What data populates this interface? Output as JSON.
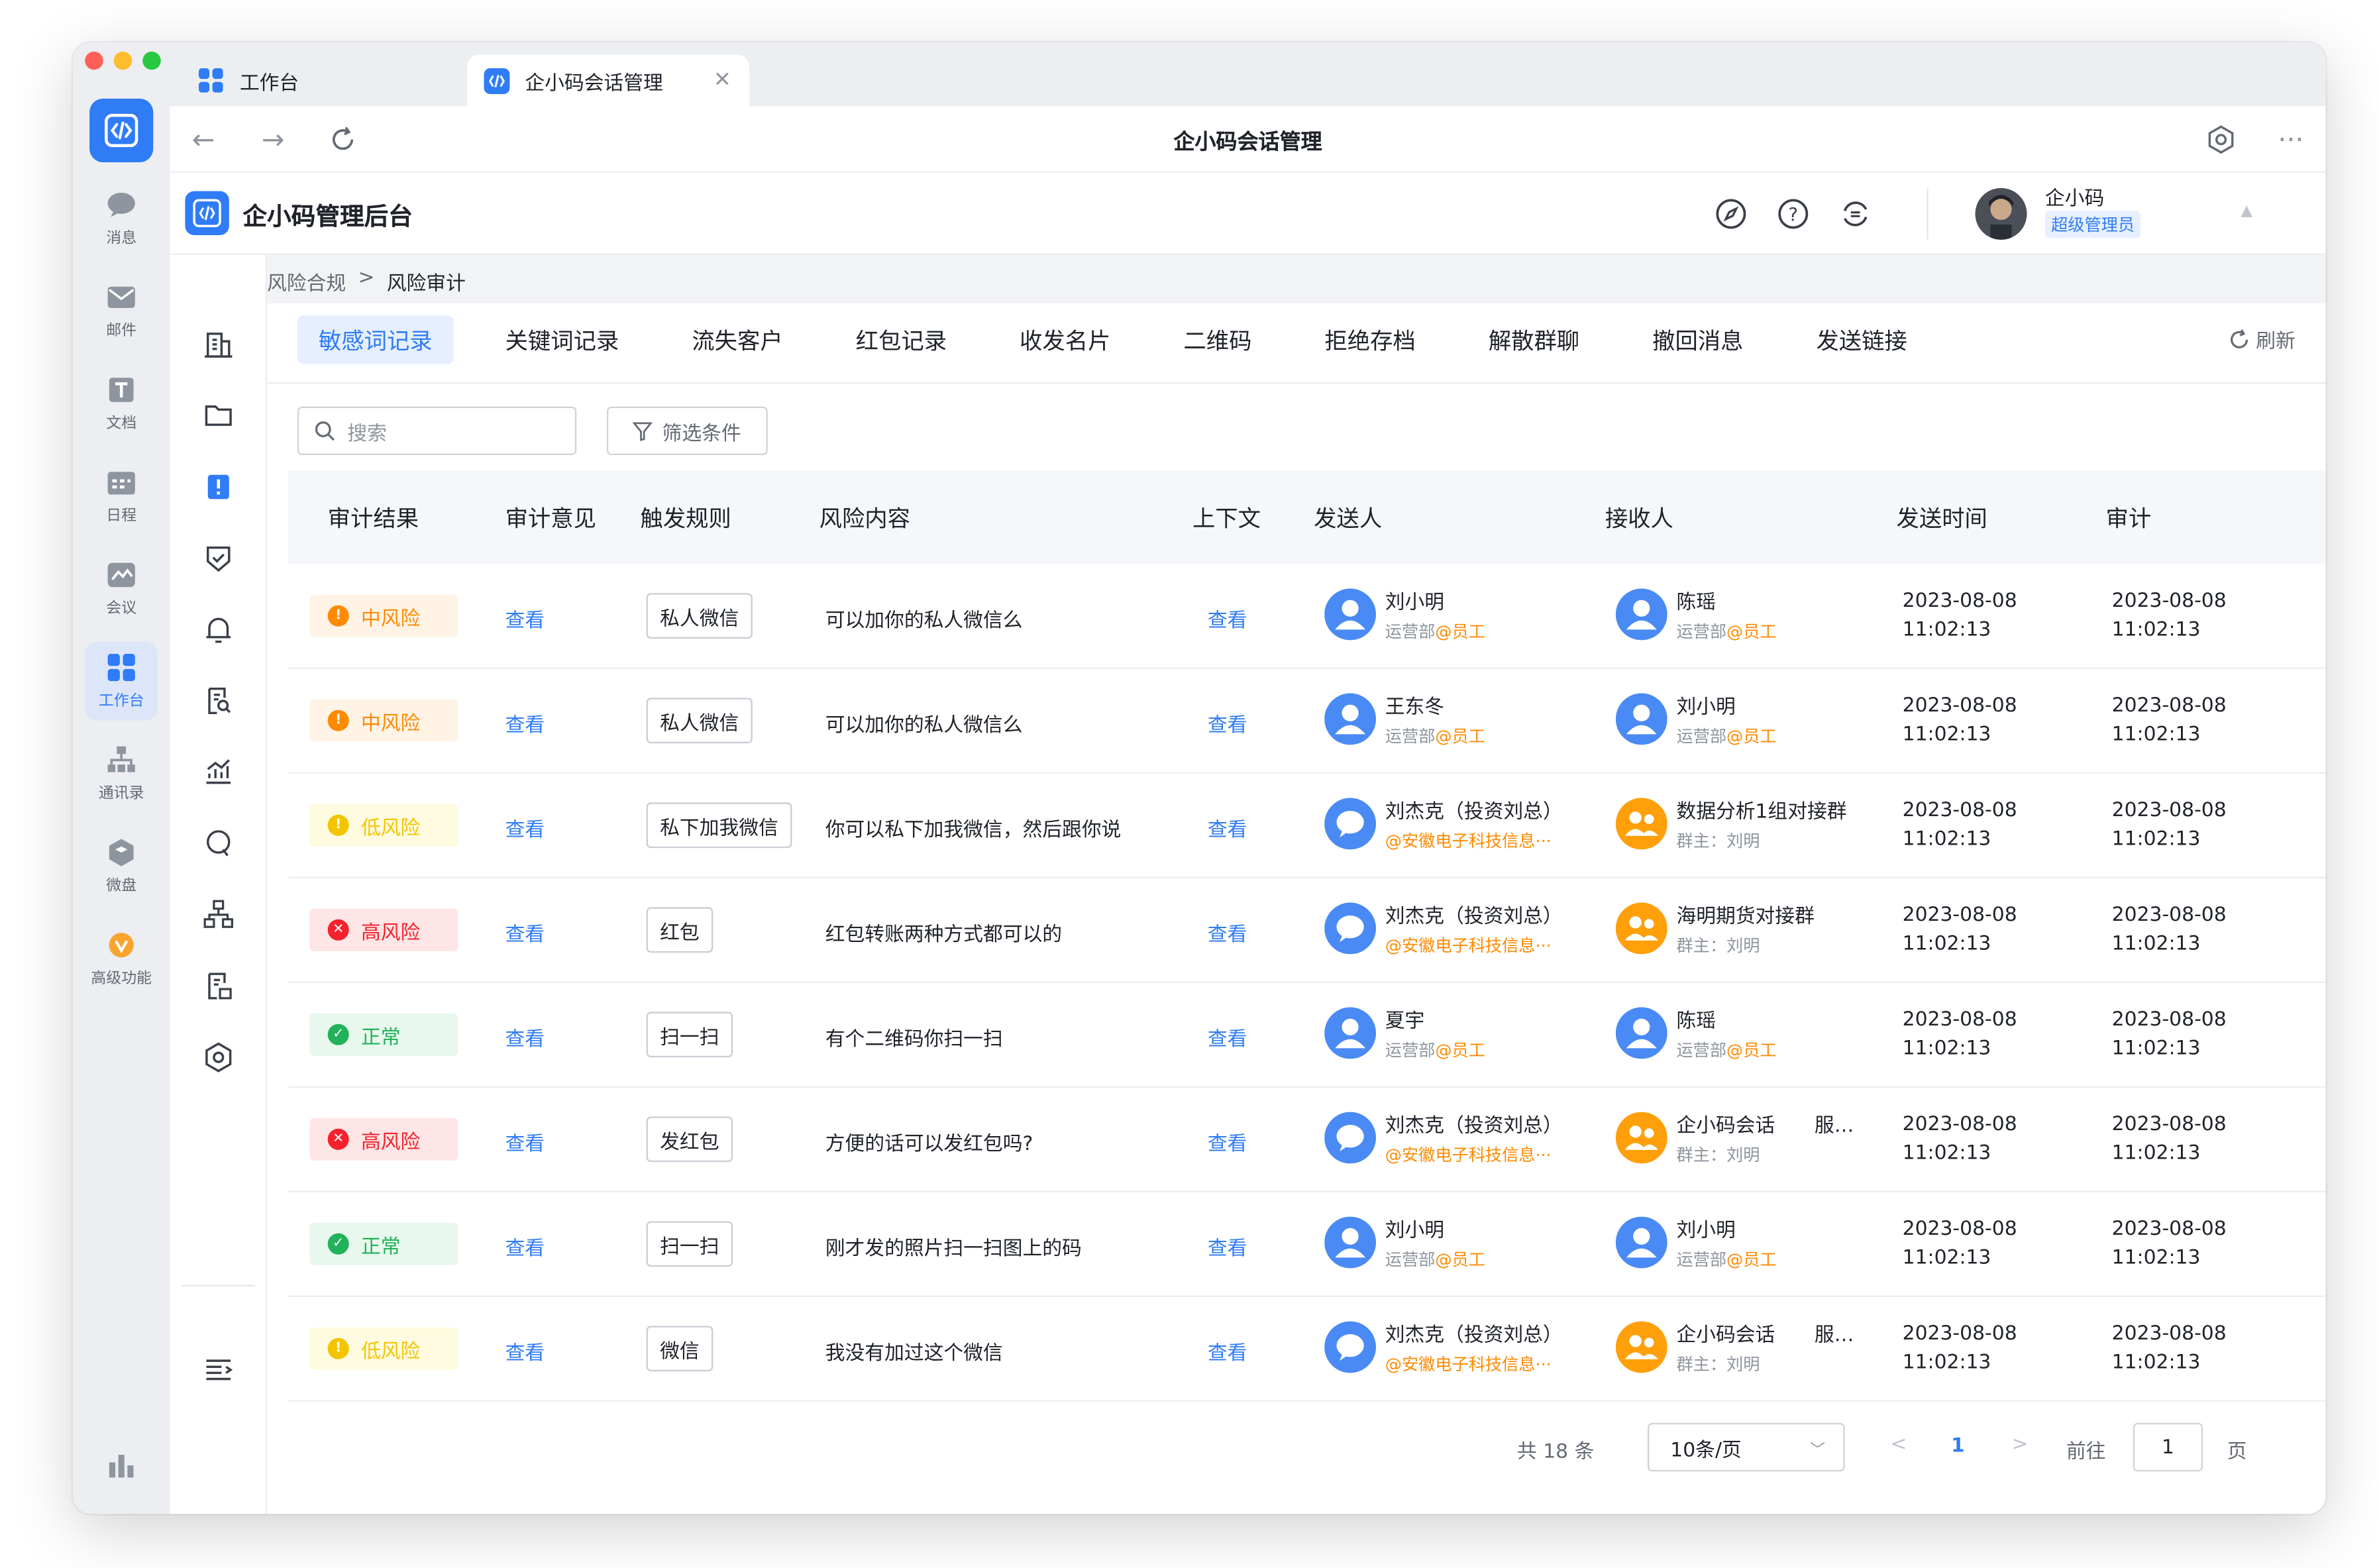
{
  "browser": {
    "tabs": [
      {
        "label": "工作台",
        "active": false
      },
      {
        "label": "企小码会话管理",
        "active": true
      }
    ],
    "page_title": "企小码会话管理"
  },
  "rail": {
    "items": [
      {
        "label": "消息",
        "icon": "message-icon",
        "active": false
      },
      {
        "label": "邮件",
        "icon": "mail-icon",
        "active": false
      },
      {
        "label": "文档",
        "icon": "document-icon",
        "active": false
      },
      {
        "label": "日程",
        "icon": "calendar-icon",
        "active": false
      },
      {
        "label": "会议",
        "icon": "meeting-icon",
        "active": false
      },
      {
        "label": "工作台",
        "icon": "workbench-icon",
        "active": true
      },
      {
        "label": "通讯录",
        "icon": "contacts-icon",
        "active": false
      },
      {
        "label": "微盘",
        "icon": "drive-icon",
        "active": false
      },
      {
        "label": "高级功能",
        "icon": "advanced-icon",
        "active": false
      }
    ]
  },
  "app": {
    "title": "企小码管理后台",
    "user_name": "企小码",
    "user_role": "超级管理员"
  },
  "breadcrumb": {
    "parent": "风险合规",
    "separator": ">",
    "current": "风险审计"
  },
  "tabs": [
    "敏感词记录",
    "关键词记录",
    "流失客户",
    "红包记录",
    "收发名片",
    "二维码",
    "拒绝存档",
    "解散群聊",
    "撤回消息",
    "发送链接"
  ],
  "refresh_label": "刷新",
  "search": {
    "placeholder": "搜索"
  },
  "filter_label": "筛选条件",
  "table": {
    "headers": [
      "审计结果",
      "审计意见",
      "触发规则",
      "风险内容",
      "上下文",
      "发送人",
      "接收人",
      "发送时间",
      "审计"
    ],
    "rows": [
      {
        "result": "中风险",
        "level": "medium",
        "opinion": "查看",
        "rule": "私人微信",
        "content": "可以加你的私人微信么",
        "context": "查看",
        "sender": {
          "name": "刘小明",
          "sub": "运营部",
          "tag": "@员工",
          "type": "staff"
        },
        "receiver": {
          "name": "陈瑶",
          "sub": "运营部",
          "tag": "@员工",
          "type": "staff"
        },
        "send_date": "2023-08-08",
        "send_time": "11:02:13",
        "audit_date": "2023-08-08",
        "audit_time": "11:02:13"
      },
      {
        "result": "中风险",
        "level": "medium",
        "opinion": "查看",
        "rule": "私人微信",
        "content": "可以加你的私人微信么",
        "context": "查看",
        "sender": {
          "name": "王东冬",
          "sub": "运营部",
          "tag": "@员工",
          "type": "staff"
        },
        "receiver": {
          "name": "刘小明",
          "sub": "运营部",
          "tag": "@员工",
          "type": "staff"
        },
        "send_date": "2023-08-08",
        "send_time": "11:02:13",
        "audit_date": "2023-08-08",
        "audit_time": "11:02:13"
      },
      {
        "result": "低风险",
        "level": "low",
        "opinion": "查看",
        "rule": "私下加我微信",
        "content": "你可以私下加我微信，然后跟你说",
        "context": "查看",
        "sender": {
          "name": "刘杰克（投资刘总）",
          "sub": "@安徽电子科技信息···",
          "tag": "",
          "type": "external"
        },
        "receiver": {
          "name": "数据分析1组对接群",
          "sub": "群主：刘明",
          "tag": "",
          "type": "group"
        },
        "send_date": "2023-08-08",
        "send_time": "11:02:13",
        "audit_date": "2023-08-08",
        "audit_time": "11:02:13"
      },
      {
        "result": "高风险",
        "level": "high",
        "opinion": "查看",
        "rule": "红包",
        "content": "红包转账两种方式都可以的",
        "context": "查看",
        "sender": {
          "name": "刘杰克（投资刘总）",
          "sub": "@安徽电子科技信息···",
          "tag": "",
          "type": "external"
        },
        "receiver": {
          "name": "海明期货对接群",
          "sub": "群主：刘明",
          "tag": "",
          "type": "group"
        },
        "send_date": "2023-08-08",
        "send_time": "11:02:13",
        "audit_date": "2023-08-08",
        "audit_time": "11:02:13"
      },
      {
        "result": "正常",
        "level": "normal",
        "opinion": "查看",
        "rule": "扫一扫",
        "content": "有个二维码你扫一扫",
        "context": "查看",
        "sender": {
          "name": "夏宇",
          "sub": "运营部",
          "tag": "@员工",
          "type": "staff"
        },
        "receiver": {
          "name": "陈瑶",
          "sub": "运营部",
          "tag": "@员工",
          "type": "staff"
        },
        "send_date": "2023-08-08",
        "send_time": "11:02:13",
        "audit_date": "2023-08-08",
        "audit_time": "11:02:13"
      },
      {
        "result": "高风险",
        "level": "high",
        "opinion": "查看",
        "rule": "发红包",
        "content": "方便的话可以发红包吗?",
        "context": "查看",
        "sender": {
          "name": "刘杰克（投资刘总）",
          "sub": "@安徽电子科技信息···",
          "tag": "",
          "type": "external"
        },
        "receiver": {
          "name": "企小码会话　　服…",
          "sub": "群主：刘明",
          "tag": "",
          "type": "group"
        },
        "send_date": "2023-08-08",
        "send_time": "11:02:13",
        "audit_date": "2023-08-08",
        "audit_time": "11:02:13"
      },
      {
        "result": "正常",
        "level": "normal",
        "opinion": "查看",
        "rule": "扫一扫",
        "content": "刚才发的照片扫一扫图上的码",
        "context": "查看",
        "sender": {
          "name": "刘小明",
          "sub": "运营部",
          "tag": "@员工",
          "type": "staff"
        },
        "receiver": {
          "name": "刘小明",
          "sub": "运营部",
          "tag": "@员工",
          "type": "staff"
        },
        "send_date": "2023-08-08",
        "send_time": "11:02:13",
        "audit_date": "2023-08-08",
        "audit_time": "11:02:13"
      },
      {
        "result": "低风险",
        "level": "low",
        "opinion": "查看",
        "rule": "微信",
        "content": "我没有加过这个微信",
        "context": "查看",
        "sender": {
          "name": "刘杰克（投资刘总）",
          "sub": "@安徽电子科技信息···",
          "tag": "",
          "type": "external"
        },
        "receiver": {
          "name": "企小码会话　　服…",
          "sub": "群主：刘明",
          "tag": "",
          "type": "group"
        },
        "send_date": "2023-08-08",
        "send_time": "11:02:13",
        "audit_date": "2023-08-08",
        "audit_time": "11:02:13"
      }
    ]
  },
  "pagination": {
    "total": "共 18 条",
    "page_size": "10条/页",
    "prev": "<",
    "current": "1",
    "next": ">",
    "goto_label": "前往",
    "goto_value": "1",
    "page_label": "页"
  },
  "colors": {
    "accent": "#2f7cf6",
    "medium_bg": "#fff3e6",
    "medium_fg": "#ff8a00",
    "low_bg": "#fffbe0",
    "low_fg": "#f5c400",
    "high_bg": "#ffe6e6",
    "high_fg": "#f5222d",
    "normal_bg": "#e8f8ee",
    "normal_fg": "#21b25a",
    "group_avatar": "#ff9f0a",
    "staff_avatar": "#4a8af4"
  }
}
